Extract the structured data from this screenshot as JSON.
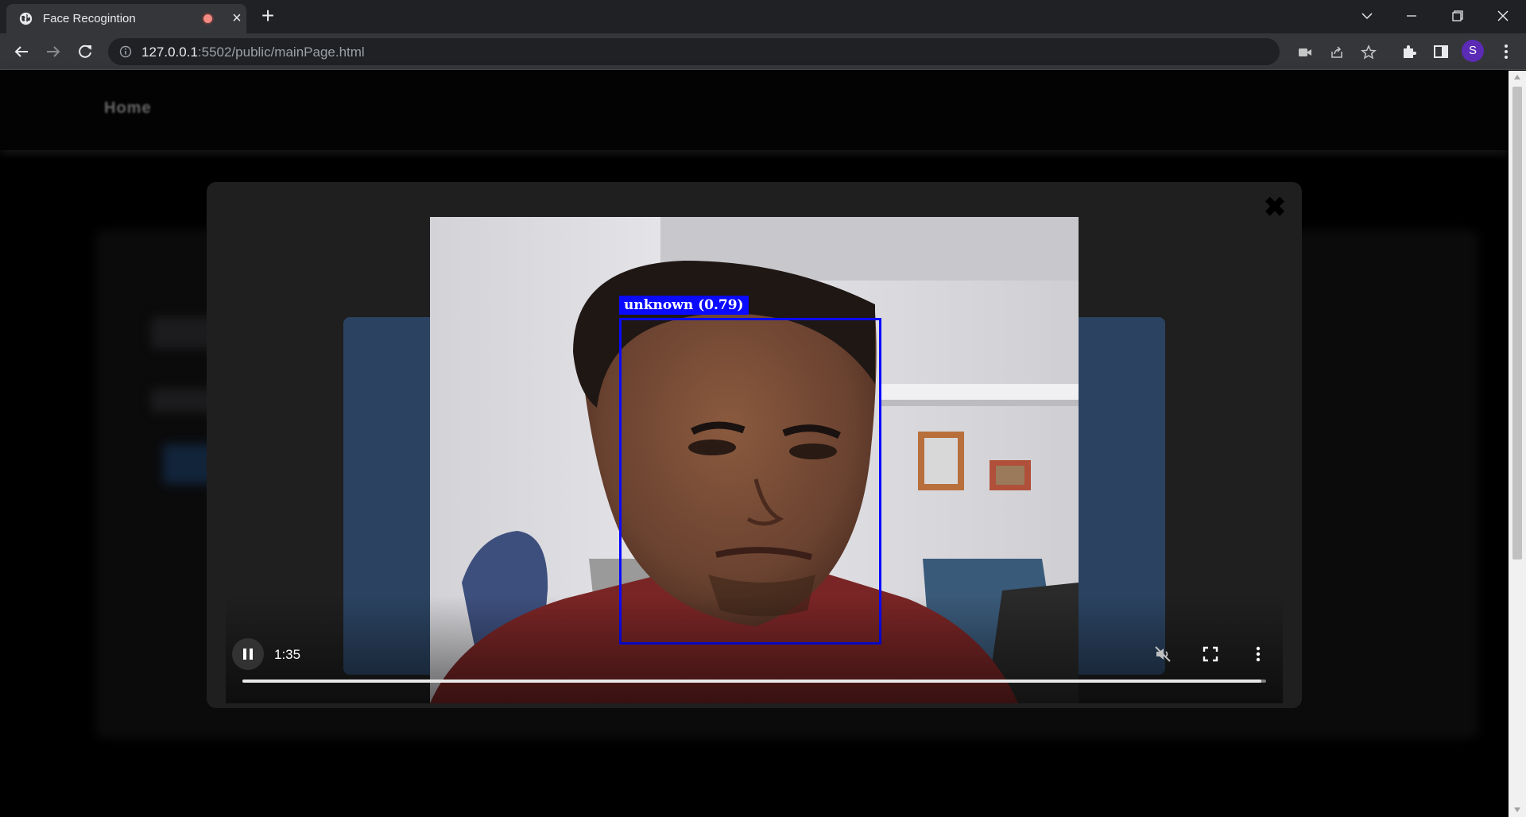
{
  "browser": {
    "tab": {
      "title": "Face Recogintion",
      "recording": true
    },
    "url": {
      "host": "127.0.0.1",
      "rest": ":5502/public/mainPage.html"
    },
    "profile_initial": "S"
  },
  "page": {
    "nav": {
      "home_label": "Home"
    }
  },
  "modal": {
    "close_symbol": "✖",
    "video": {
      "time": "1:35",
      "muted": true,
      "state": "playing",
      "progress_fraction": 0.995,
      "detection": {
        "label": "unknown (0.79)",
        "color": "#0a0aff"
      }
    }
  },
  "colors": {
    "accent_panel": "#2b4361",
    "profile": "#5b2bb5"
  }
}
